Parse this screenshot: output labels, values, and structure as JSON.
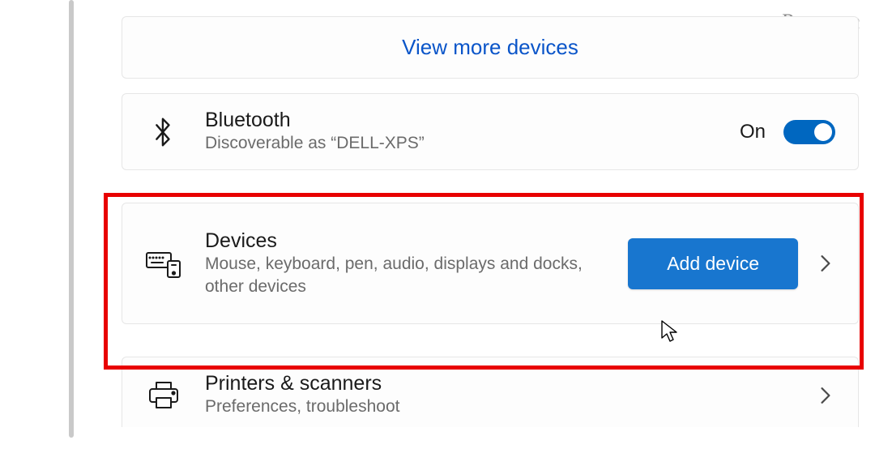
{
  "watermark": "groovyPost.com",
  "view_more": {
    "label": "View more devices"
  },
  "bluetooth": {
    "title": "Bluetooth",
    "subtitle": "Discoverable as “DELL-XPS”",
    "state_label": "On"
  },
  "devices": {
    "title": "Devices",
    "subtitle": "Mouse, keyboard, pen, audio, displays and docks, other devices",
    "add_btn": "Add device"
  },
  "printers": {
    "title": "Printers & scanners",
    "subtitle": "Preferences, troubleshoot"
  }
}
